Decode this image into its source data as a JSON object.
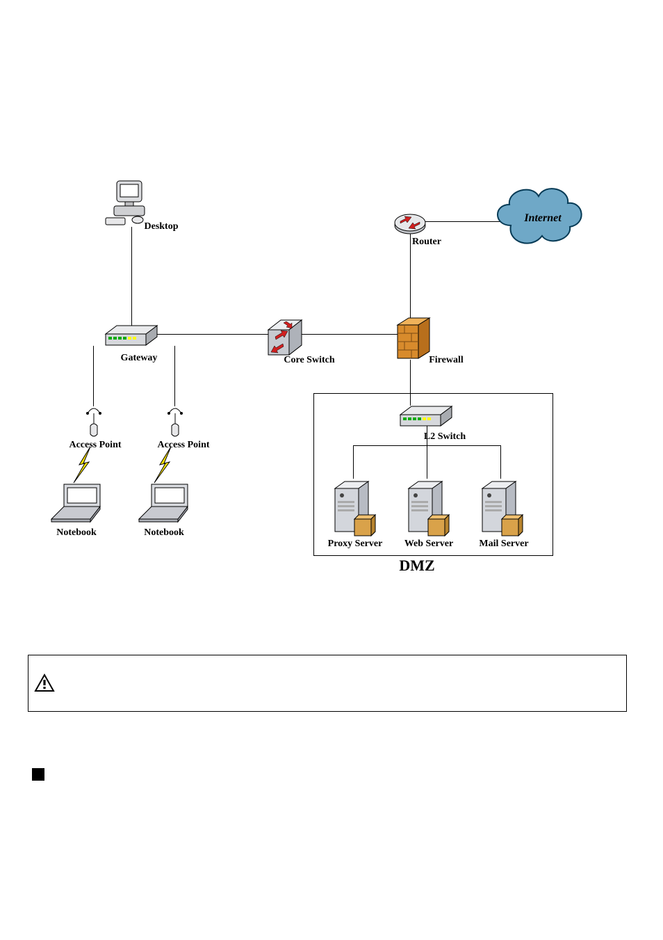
{
  "nodes": {
    "desktop": {
      "label": "Desktop"
    },
    "router": {
      "label": "Router"
    },
    "internet": {
      "label": "Internet"
    },
    "gateway": {
      "label": "Gateway"
    },
    "core_switch": {
      "label": "Core Switch"
    },
    "firewall": {
      "label": "Firewall"
    },
    "ap1": {
      "label": "Access Point"
    },
    "ap2": {
      "label": "Access Point"
    },
    "notebook1": {
      "label": "Notebook"
    },
    "notebook2": {
      "label": "Notebook"
    },
    "l2_switch": {
      "label": "L2 Switch"
    },
    "proxy": {
      "label": "Proxy Server"
    },
    "web": {
      "label": "Web Server"
    },
    "mail": {
      "label": "Mail  Server"
    }
  },
  "dmz_label": "DMZ"
}
